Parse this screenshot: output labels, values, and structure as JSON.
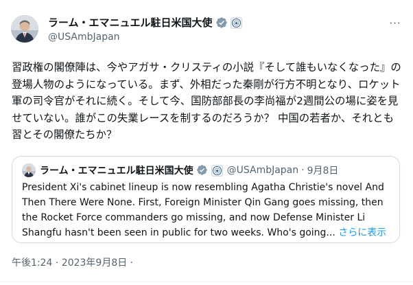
{
  "tweet": {
    "author": {
      "display_name": "ラーム・エマニュエル駐日米国大使",
      "handle": "@USAmbJapan",
      "verified_icon": "verified-check-icon",
      "affiliation_icon": "state-department-seal-icon"
    },
    "more_icon": "more-options-icon",
    "more_glyph": "···",
    "text": "習政権の閣僚陣は、今やアガサ・クリスティの小説『そして誰もいなくなった』の登場人物のようになっている。まず、外相だった秦剛が行方不明となり、ロケット軍の司令官がそれに続く。そして今、国防部部長の李尚福が2週間公の場に姿を見せていない。誰がこの失業レースを制するのだろうか？ 中国の若者か、それとも習とその閣僚たちか？",
    "quoted": {
      "display_name": "ラーム・エマニュエル駐日米国大使",
      "handle": "@USAmbJapan",
      "separator": "·",
      "date": "9月8日",
      "text": "President Xi's cabinet lineup is now resembling Agatha Christie's novel And Then There Were None. First, Foreign Minister Qin Gang goes missing, then the Rocket Force commanders go missing, and now Defense Minister Li Shangfu hasn't been seen in public for two weeks. Who's going...",
      "show_more": "さらに表示"
    },
    "timestamp": "午後1:24 · 2023年9月8日 ·"
  },
  "colors": {
    "text": "#0f1419",
    "secondary": "#536471",
    "link": "#1d9bf0",
    "verified": "#829aab",
    "border": "#cfd9de"
  }
}
